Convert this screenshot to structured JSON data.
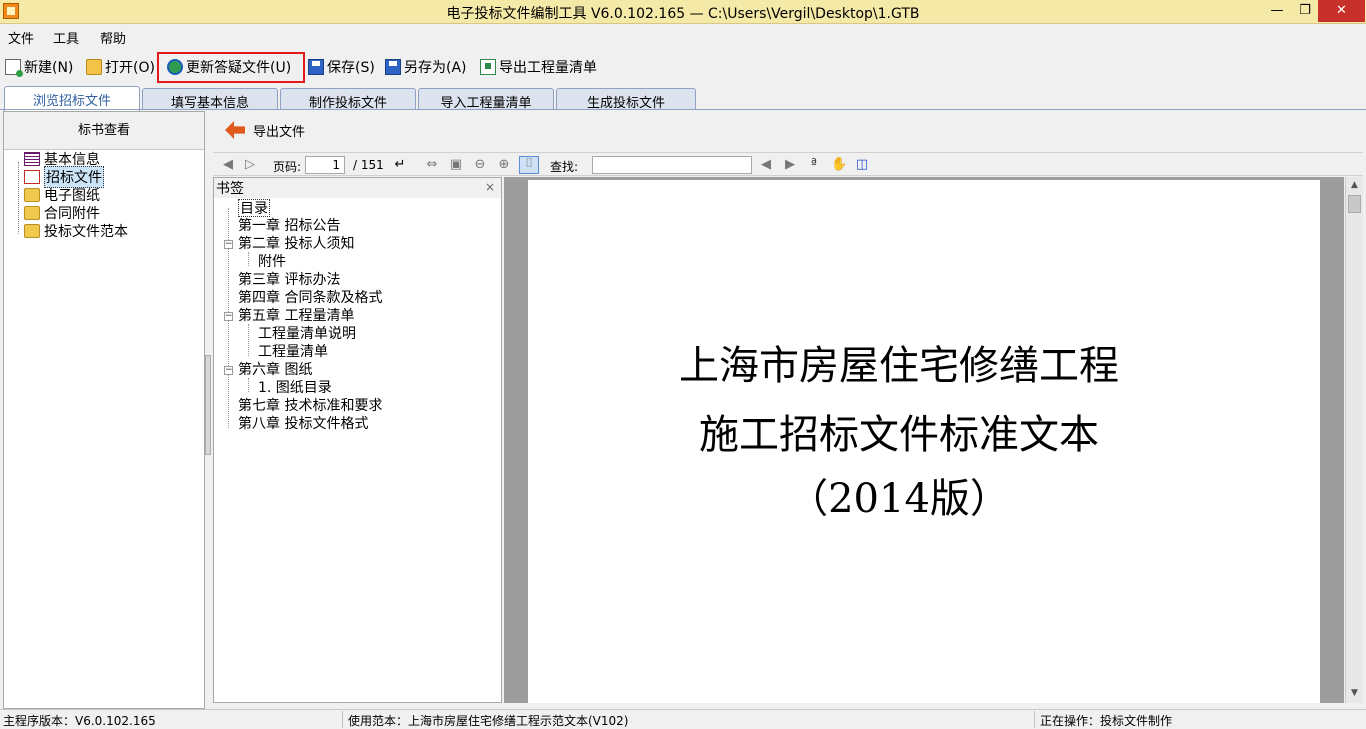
{
  "window": {
    "title": "电子投标文件编制工具 V6.0.102.165 — C:\\Users\\Vergil\\Desktop\\1.GTB",
    "minimize": "—",
    "maximize": "❐",
    "close": "✕"
  },
  "menu": {
    "file": "文件",
    "tools": "工具",
    "help": "帮助"
  },
  "toolbar": {
    "new": "新建(N)",
    "open": "打开(O)",
    "update_qa": "更新答疑文件(U)",
    "save": "保存(S)",
    "save_as": "另存为(A)",
    "export_bill": "导出工程量清单"
  },
  "tabs": [
    "浏览招标文件",
    "填写基本信息",
    "制作投标文件",
    "导入工程量清单",
    "生成投标文件"
  ],
  "left_panel": {
    "header": "标书查看",
    "items": [
      "基本信息",
      "招标文件",
      "电子图纸",
      "合同附件",
      "投标文件范本"
    ]
  },
  "export_file": "导出文件",
  "pdf_toolbar": {
    "page_label": "页码:",
    "current_page": "1",
    "total_pages": "/ 151",
    "find_label": "查找:",
    "find_value": ""
  },
  "bookmarks": {
    "header": "书签",
    "close": "×",
    "items": [
      "目录",
      "第一章 招标公告",
      "第二章 投标人须知",
      "附件",
      "第三章 评标办法",
      "第四章 合同条款及格式",
      "第五章 工程量清单",
      "工程量清单说明",
      "工程量清单",
      "第六章 图纸",
      "1. 图纸目录",
      "第七章 技术标准和要求",
      "第八章 投标文件格式"
    ]
  },
  "document": {
    "line1": "上海市房屋住宅修缮工程",
    "line2": "施工招标文件标准文本",
    "line3": "（2014版）"
  },
  "status": {
    "version": "主程序版本：V6.0.102.165",
    "template": "使用范本：上海市房屋住宅修缮工程示范文本(V102)",
    "operation": "正在操作：投标文件制作"
  }
}
